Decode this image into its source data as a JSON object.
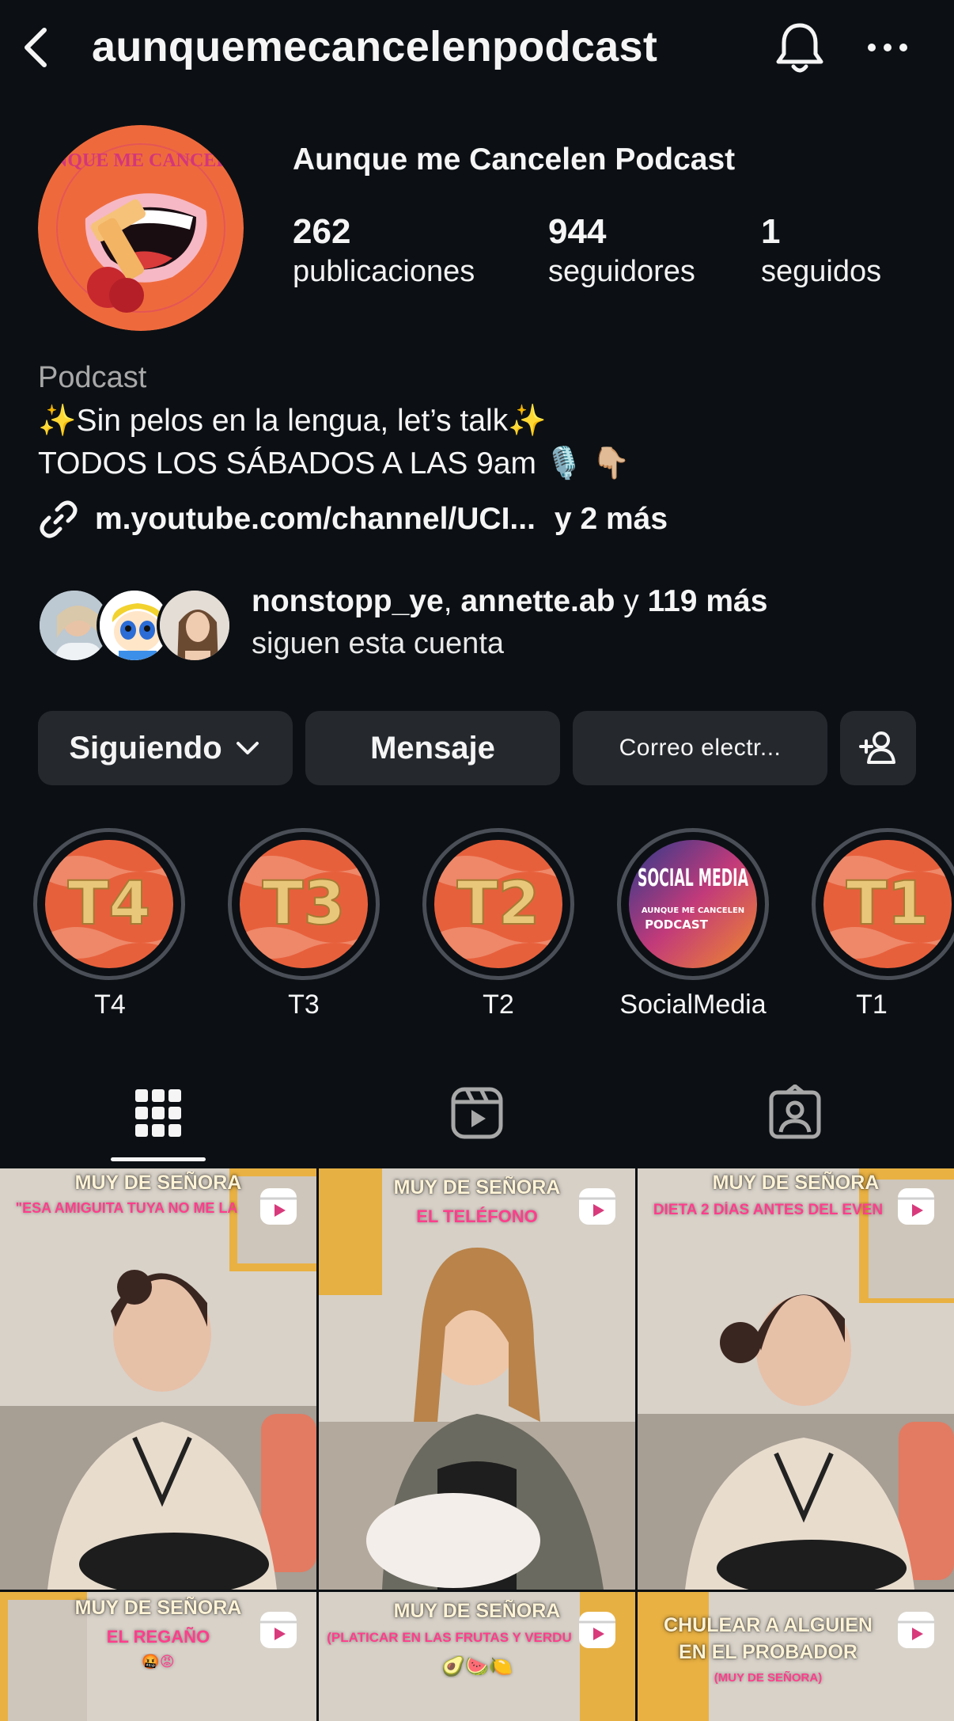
{
  "header": {
    "username": "aunquemecancelenpodcast",
    "back_icon": "chevron-left-icon",
    "bell_icon": "bell-icon",
    "more_icon": "more-horizontal-icon"
  },
  "profile": {
    "display_name": "Aunque me Cancelen Podcast",
    "avatar_logo_text": "AUNQUE ME CANCELEN",
    "stats": [
      {
        "value": "262",
        "label": "publicaciones"
      },
      {
        "value": "944",
        "label": "seguidores"
      },
      {
        "value": "1",
        "label": "seguidos"
      }
    ],
    "category": "Podcast",
    "bio_line1": "✨Sin pelos en la lengua, let’s talk✨",
    "bio_line2": "TODOS LOS SÁBADOS A LAS 9am 🎙️ 👇🏼",
    "link_url": "m.youtube.com/channel/UCI...",
    "link_more": "y 2 más",
    "followed_by": {
      "name1": "nonstopp_ye",
      "separator": ", ",
      "name2": "annette.ab",
      "connector": " y ",
      "more": "119 más",
      "line2": "siguen esta cuenta"
    }
  },
  "actions": {
    "following_label": "Siguiendo",
    "message_label": "Mensaje",
    "email_label": "Correo electr...",
    "add_person_icon": "add-person-icon"
  },
  "highlights": [
    {
      "label": "T4",
      "cover_text": "T4"
    },
    {
      "label": "T3",
      "cover_text": "T3"
    },
    {
      "label": "T2",
      "cover_text": "T2"
    },
    {
      "label": "SocialMedia",
      "cover_text": "SOCIAL MEDIA",
      "cover_sub": "AUNQUE ME CANCELEN",
      "cover_sub2": "PODCAST"
    },
    {
      "label": "T1",
      "cover_text": "T1"
    }
  ],
  "tabs": [
    {
      "name": "posts",
      "icon": "grid-icon",
      "active": true
    },
    {
      "name": "reels",
      "icon": "reels-icon",
      "active": false
    },
    {
      "name": "tagged",
      "icon": "tagged-icon",
      "active": false
    }
  ],
  "grid": [
    {
      "title": "MUY DE SEÑORA",
      "subtitle": "\"ESA AMIGUITA TUYA NO ME LA"
    },
    {
      "title": "MUY DE SEÑORA",
      "subtitle": "EL TELÉFONO"
    },
    {
      "title": "MUY DE SEÑORA",
      "subtitle": "DIETA 2 DÍAS ANTES DEL EVEN"
    },
    {
      "title": "MUY DE SEÑORA",
      "subtitle": "EL REGAÑO",
      "emoji": "🤬😡"
    },
    {
      "title": "MUY DE SEÑORA",
      "subtitle": "(PLATICAR EN LAS FRUTAS Y VERDU",
      "emoji": "🥑🍉🍋"
    },
    {
      "title": "CHULEAR A ALGUIEN",
      "title2": "EN EL PROBADOR",
      "subtitle": "(MUY DE SEÑORA)"
    }
  ]
}
